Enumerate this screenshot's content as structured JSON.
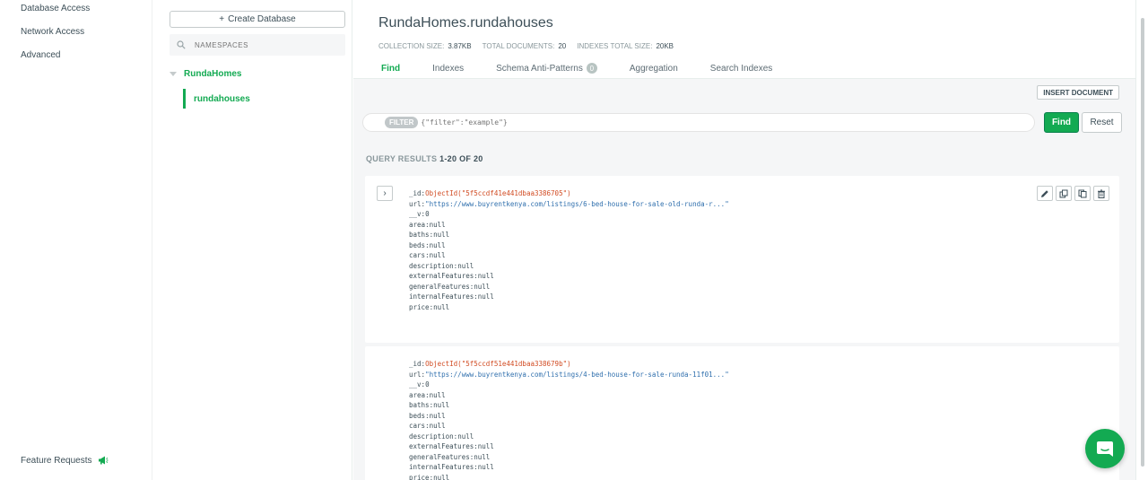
{
  "leftnav": {
    "items": [
      "Database Access",
      "Network Access",
      "Advanced"
    ],
    "feature_requests": "Feature Requests"
  },
  "dbcol": {
    "create_button": "Create Database",
    "search_placeholder": "NAMESPACES",
    "database": "RundaHomes",
    "collection": "rundahouses"
  },
  "header": {
    "title": "RundaHomes.rundahouses",
    "stats": [
      {
        "label": "COLLECTION SIZE:",
        "value": "3.87KB"
      },
      {
        "label": "TOTAL DOCUMENTS:",
        "value": "20"
      },
      {
        "label": "INDEXES TOTAL SIZE:",
        "value": "20KB"
      }
    ],
    "tabs": [
      {
        "label": "Find",
        "active": true
      },
      {
        "label": "Indexes"
      },
      {
        "label": "Schema Anti-Patterns",
        "badge": "0"
      },
      {
        "label": "Aggregation"
      },
      {
        "label": "Search Indexes"
      }
    ]
  },
  "toolbar": {
    "insert_document": "INSERT DOCUMENT",
    "filter_pill": "FILTER",
    "filter_placeholder": "{\"filter\":\"example\"}",
    "find": "Find",
    "reset": "Reset"
  },
  "results": {
    "label": "QUERY RESULTS",
    "range": "1-20 OF 20"
  },
  "documents": [
    {
      "id_key": "_id",
      "id_value": "ObjectId(\"5f5ccdf41e441dbaa3386705\")",
      "url_key": "url",
      "url_value": "\"https://www.buyrentkenya.com/listings/6-bed-house-for-sale-old-runda-r...\"",
      "v_key": "__v",
      "v_value": "0",
      "fields": [
        {
          "k": "area",
          "v": "null"
        },
        {
          "k": "baths",
          "v": "null"
        },
        {
          "k": "beds",
          "v": "null"
        },
        {
          "k": "cars",
          "v": "null"
        },
        {
          "k": "description",
          "v": "null"
        },
        {
          "k": "externalFeatures",
          "v": "null"
        },
        {
          "k": "generalFeatures",
          "v": "null"
        },
        {
          "k": "internalFeatures",
          "v": "null"
        },
        {
          "k": "price",
          "v": "null"
        }
      ]
    },
    {
      "id_key": "_id",
      "id_value": "ObjectId(\"5f5ccdf51e441dbaa338679b\")",
      "url_key": "url",
      "url_value": "\"https://www.buyrentkenya.com/listings/4-bed-house-for-sale-runda-11f01...\"",
      "v_key": "__v",
      "v_value": "0",
      "fields": [
        {
          "k": "area",
          "v": "null"
        },
        {
          "k": "baths",
          "v": "null"
        },
        {
          "k": "beds",
          "v": "null"
        },
        {
          "k": "cars",
          "v": "null"
        },
        {
          "k": "description",
          "v": "null"
        },
        {
          "k": "externalFeatures",
          "v": "null"
        },
        {
          "k": "generalFeatures",
          "v": "null"
        },
        {
          "k": "internalFeatures",
          "v": "null"
        },
        {
          "k": "price",
          "v": "null"
        }
      ]
    }
  ],
  "colors": {
    "accent": "#13aa52",
    "objectid": "#d14b22",
    "string": "#2f6fad"
  }
}
